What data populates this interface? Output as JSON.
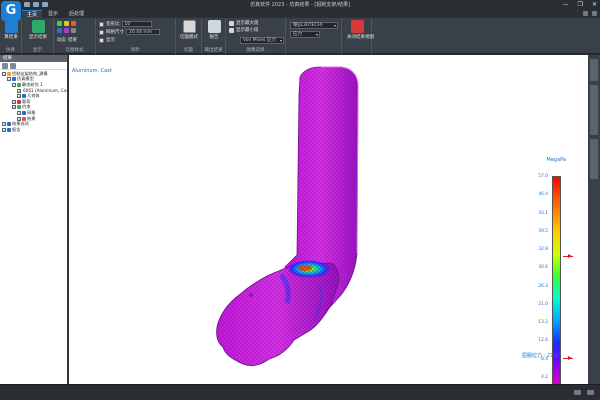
{
  "window": {
    "title": "仿真软件 2023 - 仿真结果 - [铝制支架/结果]",
    "logo": "G",
    "controls": [
      "—",
      "❐",
      "✕"
    ]
  },
  "ribbon_tabs": [
    "主页",
    "显示",
    "后处理"
  ],
  "ribbon": {
    "groups": [
      {
        "label": "仿真",
        "buttons": [
          "算结果",
          "显示选项"
        ]
      },
      {
        "label": "显示",
        "buttons": [
          "显示结果",
          "变形设置"
        ]
      },
      {
        "label": "云图样式",
        "buttons": [
          "动态",
          "结果"
        ]
      },
      {
        "label": "探针",
        "buttons": [
          "探针"
        ]
      },
      {
        "label": "切面",
        "buttons": [
          "切面模式"
        ]
      },
      {
        "label": "输出结果",
        "buttons": [
          "报告"
        ]
      },
      {
        "label": "图像选择",
        "buttons": [
          "截图"
        ]
      },
      {
        "label": "",
        "buttons": [
          "关闭结果视图"
        ]
      }
    ],
    "scale_label": "变形比",
    "scale_value": "10",
    "thickness_label": "网格尺寸",
    "thickness_value": "20.44 mm",
    "display_label": "显示",
    "result_type": "Von Mises 应力",
    "mode_label": "应力",
    "material": "钢(JL30TECH)",
    "chk_a": "显示最大值",
    "chk_b": "显示最小值"
  },
  "panel": {
    "title": "结果",
    "tree": [
      {
        "level": 0,
        "label": "铝制支架结构_建模",
        "icon": "#f0a030",
        "expanded": true
      },
      {
        "level": 1,
        "label": "仿真模型",
        "icon": "#1f6fc8",
        "expanded": true
      },
      {
        "level": 2,
        "label": "静态研究 1",
        "icon": "#2cb34a",
        "expanded": true
      },
      {
        "level": 3,
        "label": "6061 (Aluminum, Cast)",
        "icon": "#888888",
        "expanded": false
      },
      {
        "level": 3,
        "label": "几何体",
        "icon": "#1f6fc8",
        "expanded": false
      },
      {
        "level": 2,
        "label": "载荷",
        "icon": "#d63030",
        "expanded": false
      },
      {
        "level": 2,
        "label": "约束",
        "icon": "#2cb34a",
        "expanded": false
      },
      {
        "level": 3,
        "label": "网格",
        "icon": "#1f6fc8",
        "expanded": false
      },
      {
        "level": 3,
        "label": "结果",
        "icon": "#e05050",
        "expanded": false
      },
      {
        "level": 0,
        "label": "结果选项",
        "icon": "#1f6fc8",
        "expanded": false
      },
      {
        "level": 0,
        "label": "报告",
        "icon": "#1f6fc8",
        "expanded": false
      }
    ]
  },
  "viewport": {
    "material_label": "Aluminum, Cast",
    "legend_unit": "MegaPa",
    "legend_ticks": [
      "57.0",
      "46.4",
      "43.1",
      "39.5",
      "32.8",
      "30.6",
      "26.3",
      "21.0",
      "13.2",
      "12.6",
      "8.4",
      "4.2",
      "0.000007"
    ],
    "max_marker": "26.3",
    "yield_label": "屈服应力 : 27.6"
  },
  "colors": {
    "accent": "#1f6fc8",
    "ribbon_bg": "#3a4047",
    "legend_high": "#ff0000",
    "legend_low": "#ff00ff"
  }
}
